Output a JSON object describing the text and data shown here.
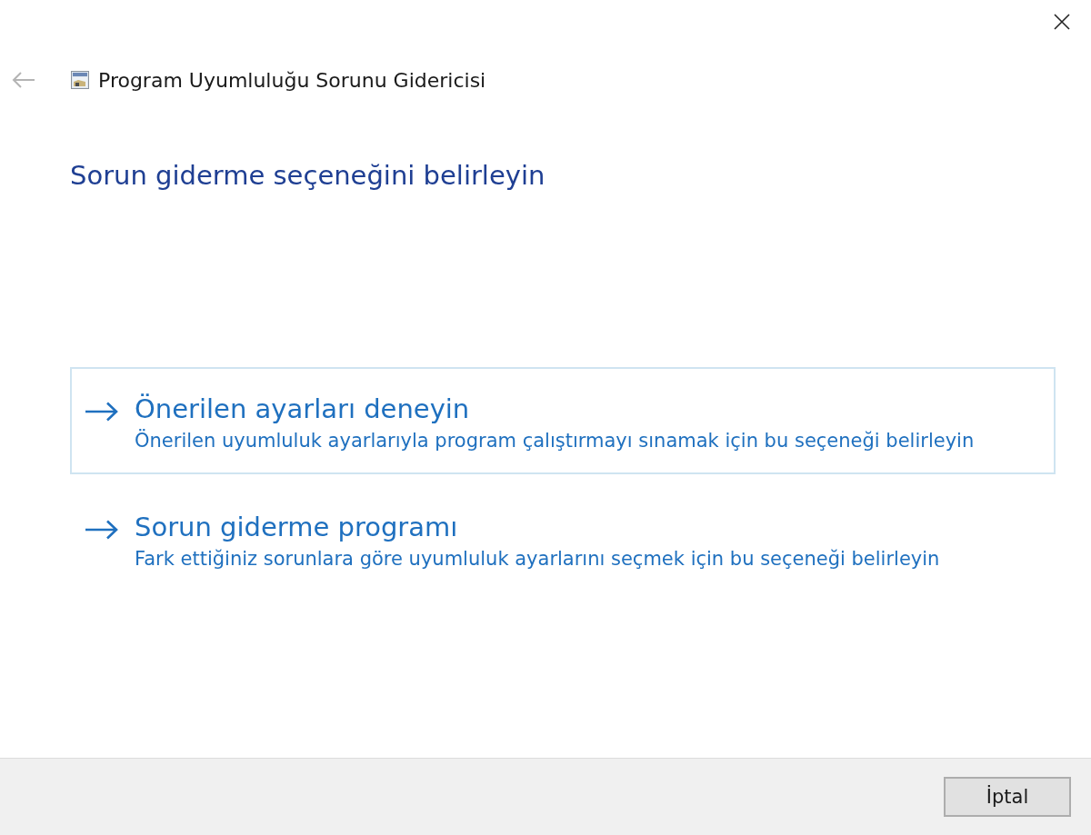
{
  "window": {
    "title": "Program Uyumluluğu Sorunu Gidericisi"
  },
  "back_button": {
    "disabled": true
  },
  "heading": "Sorun giderme seçeneğini belirleyin",
  "options": [
    {
      "title": "Önerilen ayarları deneyin",
      "description": "Önerilen uyumluluk ayarlarıyla program çalıştırmayı sınamak için bu seçeneği belirleyin",
      "selected": true
    },
    {
      "title": "Sorun giderme programı",
      "description": "Fark ettiğiniz sorunlara göre uyumluluk ayarlarını seçmek için bu seçeneği belirleyin",
      "selected": false
    }
  ],
  "footer": {
    "buttons": [
      "İptal"
    ]
  }
}
